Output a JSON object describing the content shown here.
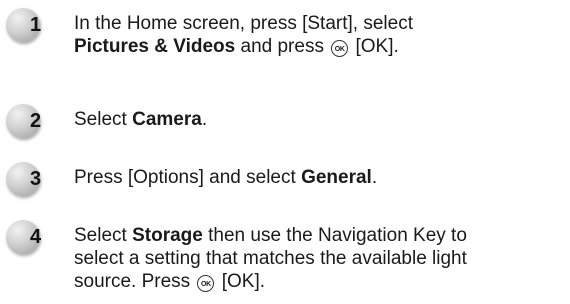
{
  "steps": [
    {
      "number": "1",
      "line1_pre": "In the Home screen, press [Start], select",
      "line2_bold": "Pictures & Videos",
      "line2_mid": " and press ",
      "line2_post": " [OK]."
    },
    {
      "number": "2",
      "pre": "Select ",
      "bold": "Camera",
      "post": "."
    },
    {
      "number": "3",
      "pre": "Press [Options] and select ",
      "bold": "General",
      "post": "."
    },
    {
      "number": "4",
      "pre": "Select ",
      "bold": "Storage",
      "mid": " then use the Navigation Key to",
      "line2": "select a setting that matches the available light",
      "line3_pre": "source. Press ",
      "line3_post": " [OK]."
    }
  ],
  "icons": {
    "ok_icon_text": "OK"
  }
}
